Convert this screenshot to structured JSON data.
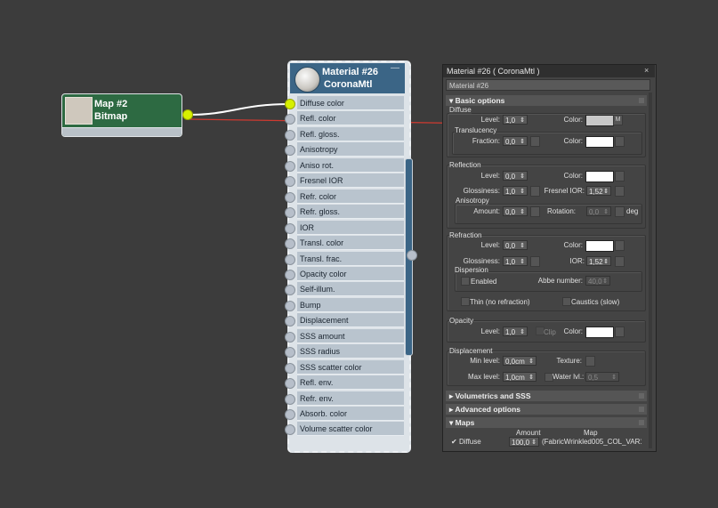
{
  "colors": {
    "background": "#3c3c3c",
    "bitmap_node": "#2d6a42",
    "material_header": "#3b6586",
    "socket_active": "#d6f000",
    "wire_red": "#d03a30"
  },
  "map_node": {
    "title": "Map #2",
    "type": "Bitmap"
  },
  "material_node": {
    "title": "Material #26",
    "type": "CoronaMtl",
    "collapse": "—",
    "slots": [
      "Diffuse color",
      "Refl. color",
      "Refl. gloss.",
      "Anisotropy",
      "Aniso rot.",
      "Fresnel IOR",
      "Refr. color",
      "Refr. gloss.",
      "IOR",
      "Transl. color",
      "Transl. frac.",
      "Opacity color",
      "Self-illum.",
      "Bump",
      "Displacement",
      "SSS amount",
      "SSS radius",
      "SSS scatter color",
      "Refl. env.",
      "Refr. env.",
      "Absorb. color",
      "Volume scatter color"
    ]
  },
  "panel": {
    "title": "Material #26  ( CoronaMtl )",
    "close": "×",
    "name": "Material #26",
    "basic": "Basic options",
    "diffuse": {
      "label": "Diffuse",
      "level_label": "Level:",
      "level": "1,0",
      "color_label": "Color:",
      "map_btn": "M"
    },
    "translucency": {
      "label": "Translucency",
      "fraction_label": "Fraction:",
      "fraction": "0,0",
      "color_label": "Color:"
    },
    "reflection": {
      "label": "Reflection",
      "level_label": "Level:",
      "level": "0,0",
      "color_label": "Color:",
      "gloss_label": "Glossiness:",
      "gloss": "1,0",
      "fresnel_label": "Fresnel IOR:",
      "fresnel": "1,52",
      "aniso_label": "Anisotropy",
      "amount_label": "Amount:",
      "amount": "0,0",
      "rotation_label": "Rotation:",
      "rotation": "0,0",
      "deg": "deg"
    },
    "refraction": {
      "label": "Refraction",
      "level_label": "Level:",
      "level": "0,0",
      "color_label": "Color:",
      "gloss_label": "Glossiness:",
      "gloss": "1,0",
      "ior_label": "IOR:",
      "ior": "1,52",
      "dispersion_label": "Dispersion",
      "enabled_label": "Enabled",
      "abbe_label": "Abbe number:",
      "abbe": "40,0",
      "thin_label": "Thin (no refraction)",
      "caustics_label": "Caustics (slow)"
    },
    "opacity": {
      "label": "Opacity",
      "level_label": "Level:",
      "level": "1,0",
      "clip_label": "Clip",
      "color_label": "Color:"
    },
    "displacement": {
      "label": "Displacement",
      "min_label": "Min level:",
      "min": "0,0cm",
      "texture_label": "Texture:",
      "max_label": "Max level:",
      "max": "1,0cm",
      "water_label": "Water lvl.:",
      "water": "0,5"
    },
    "volumetrics": "Volumetrics and SSS",
    "advanced": "Advanced options",
    "maps": "Maps",
    "maps_table": {
      "amount_header": "Amount",
      "map_header": "Map",
      "row": {
        "label": "Diffuse",
        "amount": "100,0",
        "map": "(FabricWrinkled005_COL_VAR1_"
      }
    }
  }
}
